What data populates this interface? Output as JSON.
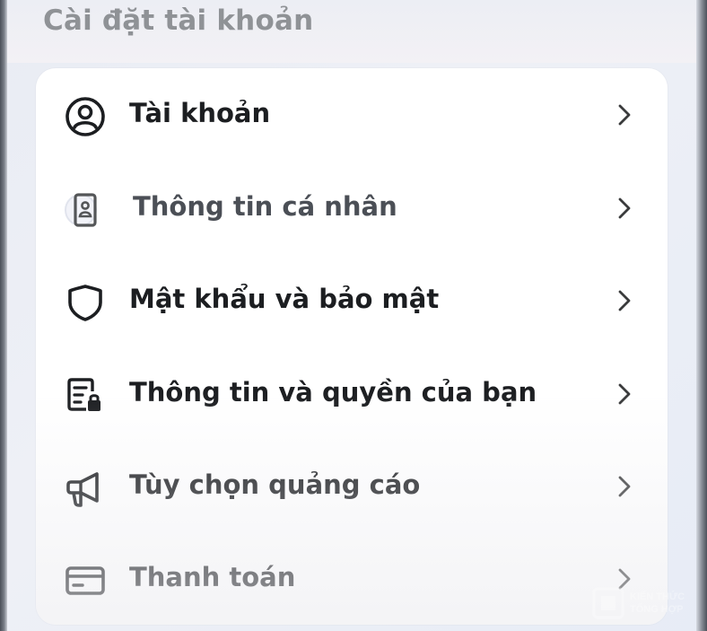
{
  "header": {
    "title": "Cài đặt tài khoản"
  },
  "menu": {
    "items": [
      {
        "label": "Tài khoản",
        "icon": "account-circle-icon"
      },
      {
        "label": "Thông tin cá nhân",
        "icon": "id-card-icon"
      },
      {
        "label": "Mật khẩu và bảo mật",
        "icon": "shield-icon"
      },
      {
        "label": "Thông tin và quyền của bạn",
        "icon": "document-lock-icon"
      },
      {
        "label": "Tùy chọn quảng cáo",
        "icon": "megaphone-icon"
      },
      {
        "label": "Thanh toán",
        "icon": "credit-card-icon"
      }
    ]
  },
  "watermark": {
    "line1": "KIẾN THỨC",
    "line2": "TỔNG HỢP"
  }
}
